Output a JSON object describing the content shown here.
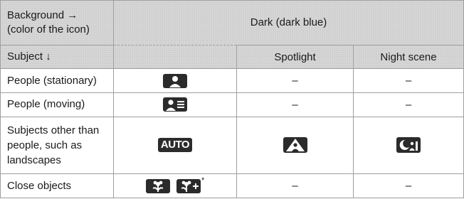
{
  "header": {
    "background_label": "Background →",
    "icon_color_label": "(color of the icon)",
    "subject_label": "Subject ↓",
    "dark_label": "Dark (dark blue)",
    "spotlight_label": "Spotlight",
    "night_scene_label": "Night scene"
  },
  "rows": [
    {
      "subject": "People (stationary)",
      "icon": "person-portrait-icon",
      "spotlight": "–",
      "night": "–"
    },
    {
      "subject": "People (moving)",
      "icon": "person-moving-icon",
      "spotlight": "–",
      "night": "–"
    },
    {
      "subject_lines": [
        "Subjects other than",
        "people, such as",
        "landscapes"
      ],
      "icon_text": "AUTO",
      "spotlight_icon": "spotlight-icon",
      "night_icon": "night-scene-icon"
    },
    {
      "subject": "Close objects",
      "icons": [
        "macro-flower-icon",
        "macro-flower-plus-icon"
      ],
      "footnote_mark": "*",
      "spotlight": "–",
      "night": "–"
    }
  ],
  "colors": {
    "header_bg": "#d7d7d7",
    "border": "#9e9e9e",
    "icon_bg": "#2b2b2b"
  }
}
